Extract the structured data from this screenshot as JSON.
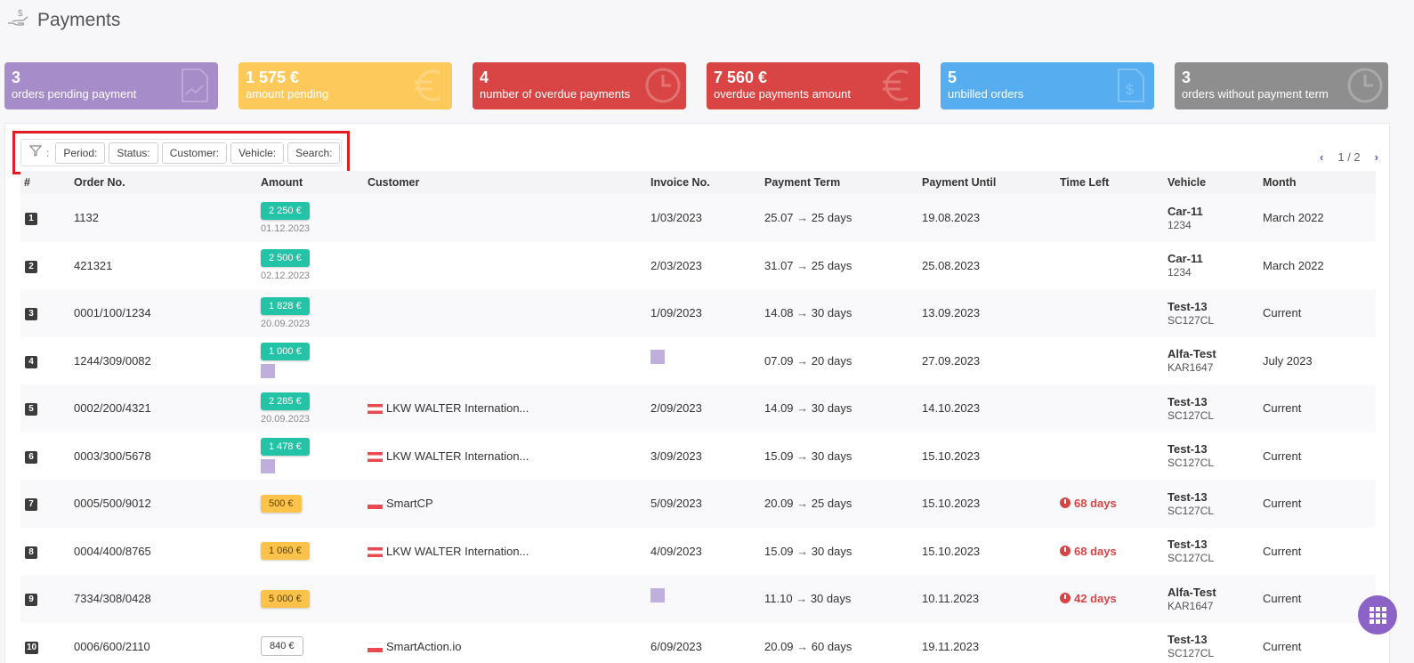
{
  "page": {
    "title": "Payments",
    "icon": "hand-dollar-icon"
  },
  "cards": [
    {
      "value": "3",
      "label": "orders pending payment",
      "color": "#a68cc8",
      "icon": "document-chart-icon"
    },
    {
      "value": "1 575 €",
      "label": "amount pending",
      "color": "#fdc95a",
      "icon": "euro-icon"
    },
    {
      "value": "4",
      "label": "number of overdue payments",
      "color": "#d94444",
      "icon": "clock-icon"
    },
    {
      "value": "7 560 €",
      "label": "overdue payments amount",
      "color": "#d94444",
      "icon": "euro-icon"
    },
    {
      "value": "5",
      "label": "unbilled orders",
      "color": "#56aef0",
      "icon": "invoice-dollar-icon"
    },
    {
      "value": "3",
      "label": "orders without payment term",
      "color": "#8e8e8e",
      "icon": "clock-icon"
    }
  ],
  "filters": {
    "colon": ":",
    "period": "Period:",
    "status": "Status:",
    "customer": "Customer:",
    "vehicle": "Vehicle:",
    "search": "Search:"
  },
  "pager": {
    "text": "1 / 2",
    "prev": "‹",
    "next": "›"
  },
  "columns": {
    "idx": "#",
    "order": "Order No.",
    "amount": "Amount",
    "customer": "Customer",
    "invoice": "Invoice No.",
    "term": "Payment Term",
    "until": "Payment Until",
    "timeleft": "Time Left",
    "vehicle": "Vehicle",
    "month": "Month"
  },
  "rows": [
    {
      "idx": "1",
      "order": "1132",
      "amount": "2 250 €",
      "amount_style": "teal",
      "amount_date": "01.12.2023",
      "customer": "",
      "flag": "",
      "invoice": "1/03/2023",
      "term_date": "25.07",
      "term_days": "25 days",
      "until": "19.08.2023",
      "timeleft": "",
      "vehicle": "Car-11",
      "plate": "1234",
      "month": "March 2022"
    },
    {
      "idx": "2",
      "order": "421321",
      "amount": "2 500 €",
      "amount_style": "teal",
      "amount_date": "02.12.2023",
      "customer": "",
      "flag": "",
      "invoice": "2/03/2023",
      "term_date": "31.07",
      "term_days": "25 days",
      "until": "25.08.2023",
      "timeleft": "",
      "vehicle": "Car-11",
      "plate": "1234",
      "month": "March 2022"
    },
    {
      "idx": "3",
      "order": "0001/100/1234",
      "amount": "1 828 €",
      "amount_style": "teal",
      "amount_date": "20.09.2023",
      "customer": "",
      "flag": "",
      "invoice": "1/09/2023",
      "term_date": "14.08",
      "term_days": "30 days",
      "until": "13.09.2023",
      "timeleft": "",
      "vehicle": "Test-13",
      "plate": "SC127CL",
      "month": "Current"
    },
    {
      "idx": "4",
      "order": "1244/309/0082",
      "amount": "1 000 €",
      "amount_style": "teal",
      "amount_date": "",
      "customer": "",
      "flag": "",
      "invoice": "",
      "term_date": "07.09",
      "term_days": "20 days",
      "until": "27.09.2023",
      "timeleft": "",
      "vehicle": "Alfa-Test",
      "plate": "KAR1647",
      "month": "July 2023"
    },
    {
      "idx": "5",
      "order": "0002/200/4321",
      "amount": "2 285 €",
      "amount_style": "teal",
      "amount_date": "20.09.2023",
      "customer": "LKW WALTER Internation...",
      "flag": "at",
      "invoice": "2/09/2023",
      "term_date": "14.09",
      "term_days": "30 days",
      "until": "14.10.2023",
      "timeleft": "",
      "vehicle": "Test-13",
      "plate": "SC127CL",
      "month": "Current"
    },
    {
      "idx": "6",
      "order": "0003/300/5678",
      "amount": "1 478 €",
      "amount_style": "teal",
      "amount_date": "",
      "customer": "LKW WALTER Internation...",
      "flag": "at",
      "invoice": "3/09/2023",
      "term_date": "15.09",
      "term_days": "30 days",
      "until": "15.10.2023",
      "timeleft": "",
      "vehicle": "Test-13",
      "plate": "SC127CL",
      "month": "Current"
    },
    {
      "idx": "7",
      "order": "0005/500/9012",
      "amount": "500 €",
      "amount_style": "orange",
      "amount_date": "",
      "customer": "SmartCP",
      "flag": "pl",
      "invoice": "5/09/2023",
      "term_date": "20.09",
      "term_days": "25 days",
      "until": "15.10.2023",
      "timeleft": "68 days",
      "vehicle": "Test-13",
      "plate": "SC127CL",
      "month": "Current"
    },
    {
      "idx": "8",
      "order": "0004/400/8765",
      "amount": "1 060 €",
      "amount_style": "orange",
      "amount_date": "",
      "customer": "LKW WALTER Internation...",
      "flag": "at",
      "invoice": "4/09/2023",
      "term_date": "15.09",
      "term_days": "30 days",
      "until": "15.10.2023",
      "timeleft": "68 days",
      "vehicle": "Test-13",
      "plate": "SC127CL",
      "month": "Current"
    },
    {
      "idx": "9",
      "order": "7334/308/0428",
      "amount": "5 000 €",
      "amount_style": "orange",
      "amount_date": "",
      "customer": "",
      "flag": "",
      "invoice": "",
      "term_date": "11.10",
      "term_days": "30 days",
      "until": "10.11.2023",
      "timeleft": "42 days",
      "vehicle": "Alfa-Test",
      "plate": "KAR1647",
      "month": "Current"
    },
    {
      "idx": "10",
      "order": "0006/600/2110",
      "amount": "840 €",
      "amount_style": "white",
      "amount_date": "",
      "customer": "SmartAction.io",
      "flag": "pl",
      "invoice": "6/09/2023",
      "term_date": "20.09",
      "term_days": "60 days",
      "until": "19.11.2023",
      "timeleft": "",
      "vehicle": "Test-13",
      "plate": "SC127CL",
      "month": "Current"
    }
  ],
  "fab": {
    "icon": "apps-grid-icon"
  }
}
